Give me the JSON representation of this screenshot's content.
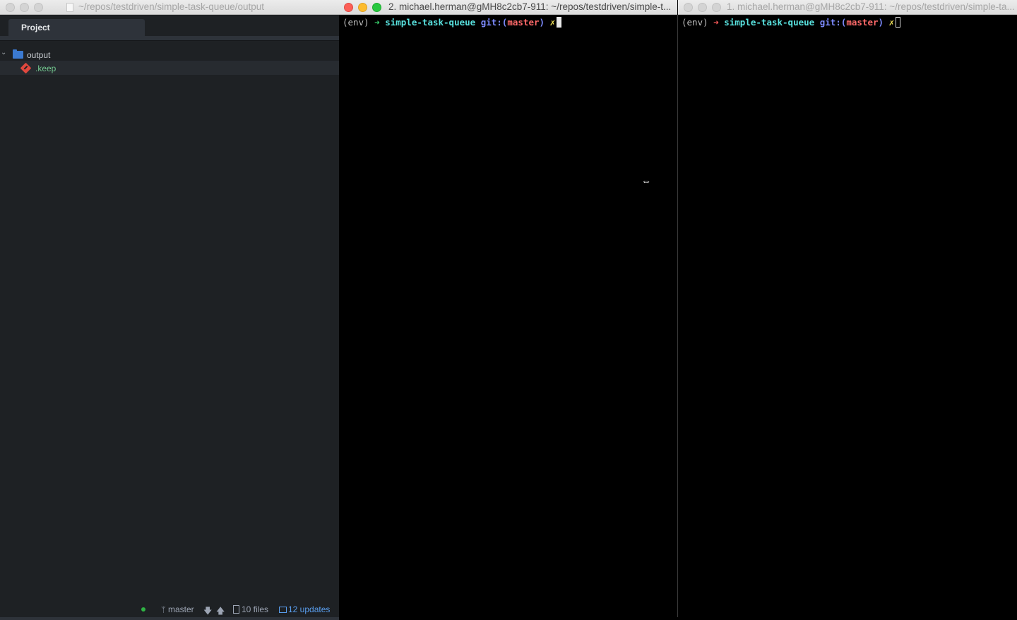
{
  "atom": {
    "window_title": "~/repos/testdriven/simple-task-queue/output",
    "tab_label": "Project",
    "tree": {
      "folder": "output",
      "file": ".keep"
    },
    "status": {
      "branch": "master",
      "files": "10 files",
      "updates": "12 updates"
    }
  },
  "terminal_right_pane_active": {
    "window_title": "2. michael.herman@gMH8c2cb7-911: ~/repos/testdriven/simple-t...",
    "prompt": {
      "env": "(env)",
      "arrow": "➜",
      "dir": "simple-task-queue",
      "git": "git:(",
      "branch": "master",
      "git_close": ")",
      "dirty": "✗"
    }
  },
  "terminal_far_right": {
    "window_title": "1. michael.herman@gMH8c2cb7-911: ~/repos/testdriven/simple-ta...",
    "prompt": {
      "env": "(env)",
      "arrow": "➜",
      "dir": "simple-task-queue",
      "git": "git:(",
      "branch": "master",
      "git_close": ")",
      "dirty": "✗"
    }
  },
  "icons": [
    "folder-icon",
    "git-file-icon",
    "branch-icon",
    "arrow-down-icon",
    "arrow-up-icon",
    "file-icon",
    "package-icon",
    "resize-cursor-icon"
  ],
  "colors": {
    "editor_bg": "#1e2124",
    "terminal_bg": "#000000",
    "prompt_dir": "#59e3e0",
    "prompt_branch": "#ff6a6a",
    "untracked_file": "#73c990",
    "updates_link": "#5a9ff0"
  }
}
